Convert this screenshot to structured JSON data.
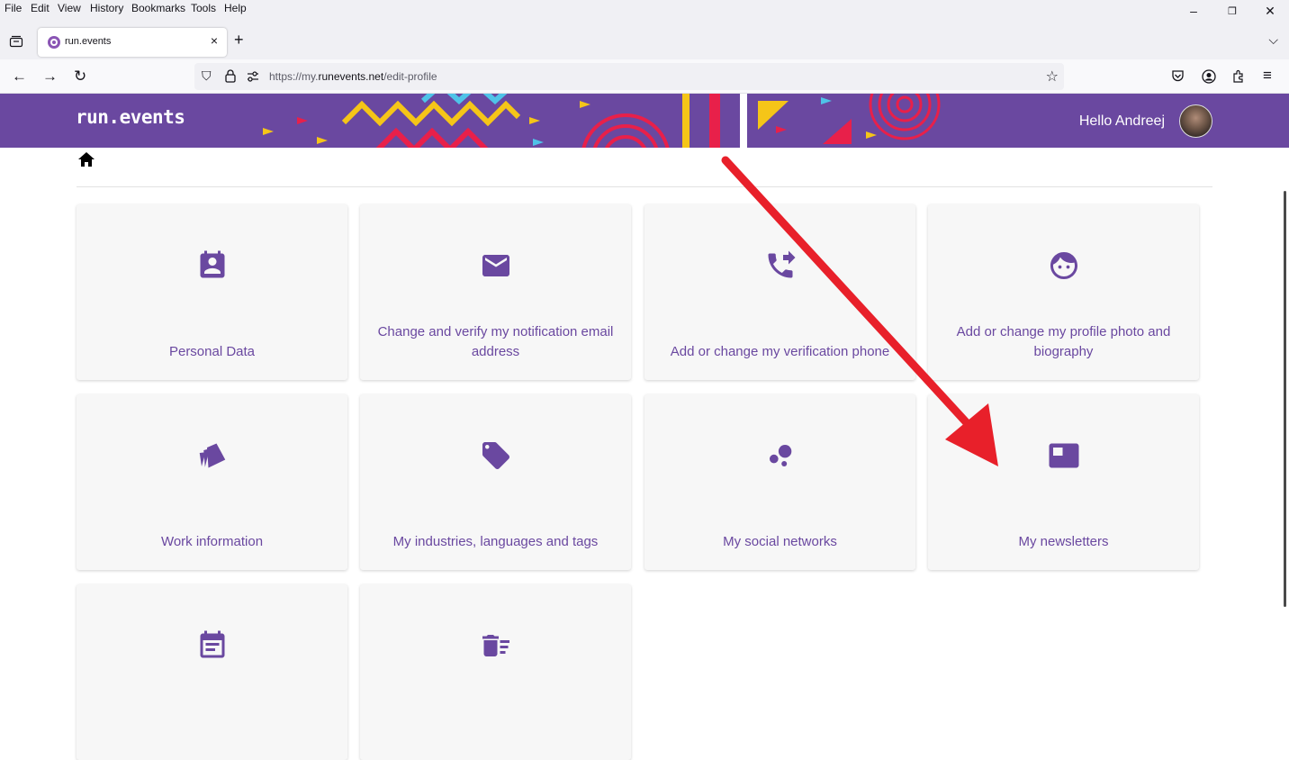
{
  "menubar": {
    "items": [
      "File",
      "Edit",
      "View",
      "History",
      "Bookmarks",
      "Tools",
      "Help"
    ]
  },
  "tab": {
    "title": "run.events",
    "close": "×",
    "new": "+"
  },
  "urlbar": {
    "prefix": "https://my.",
    "domain": "runevents.net",
    "path": "/edit-profile"
  },
  "header": {
    "logo": "run.events",
    "greeting": "Hello Andreej"
  },
  "cards": [
    {
      "icon": "contact-calendar-icon",
      "label": "Personal Data"
    },
    {
      "icon": "mail-icon",
      "label": "Change and verify my notification email address"
    },
    {
      "icon": "phone-forward-icon",
      "label": "Add or change my verification phone"
    },
    {
      "icon": "face-icon",
      "label": "Add or change my profile photo and biography"
    },
    {
      "icon": "swatch-book-icon",
      "label": "Work information"
    },
    {
      "icon": "tag-icon",
      "label": "My industries, languages and tags"
    },
    {
      "icon": "bubble-chart-icon",
      "label": "My social networks"
    },
    {
      "icon": "newsletter-icon",
      "label": "My newsletters"
    },
    {
      "icon": "event-note-icon",
      "label": ""
    },
    {
      "icon": "delete-sweep-icon",
      "label": ""
    }
  ],
  "colors": {
    "brand": "#6a48a0",
    "card_bg": "#f7f7f7",
    "annotation_arrow": "#e8202a"
  }
}
